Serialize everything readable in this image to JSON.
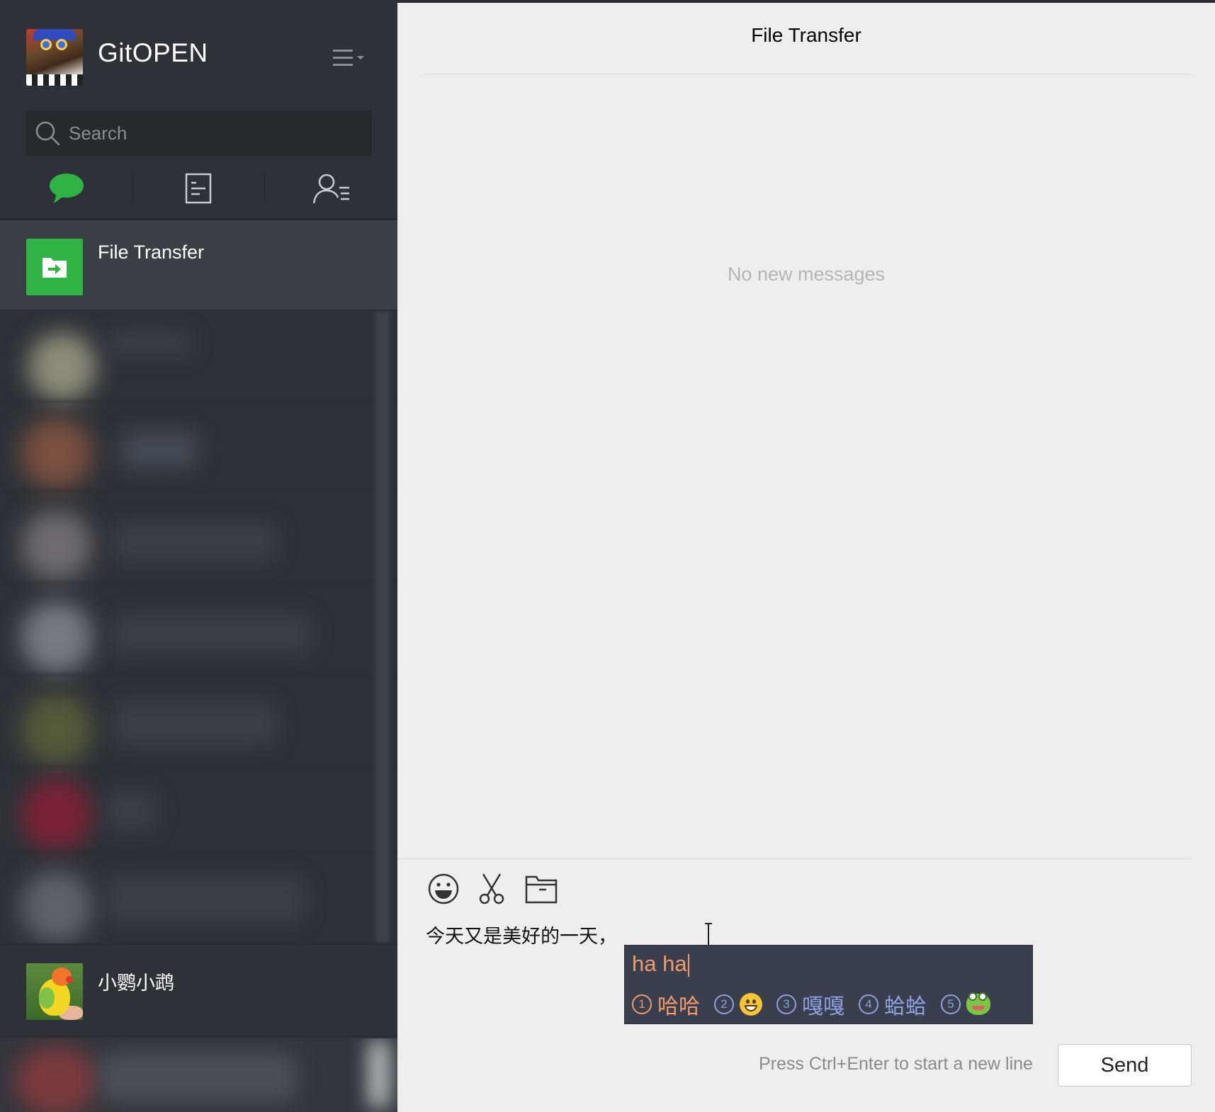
{
  "profile": {
    "name": "GitOPEN",
    "avatar_icon": "user-avatar-icon",
    "menu_icon": "menu-icon"
  },
  "search": {
    "placeholder": "Search",
    "icon": "search-icon"
  },
  "tabs": [
    {
      "name": "chats",
      "icon": "chat-bubble-icon",
      "active": true,
      "color": "#2fb344"
    },
    {
      "name": "articles",
      "icon": "document-icon",
      "active": false
    },
    {
      "name": "contacts",
      "icon": "contacts-icon",
      "active": false
    }
  ],
  "chats": [
    {
      "name": "File Transfer",
      "icon": "file-transfer-icon",
      "active": true
    },
    {
      "name": "小鹦小鹉",
      "icon": "parrot-avatar-icon",
      "active": false
    }
  ],
  "conversation": {
    "title": "File Transfer",
    "empty_text": "No new messages"
  },
  "composer": {
    "tools": [
      "emoji-icon",
      "scissors-icon",
      "folder-icon"
    ],
    "text": "今天又是美好的一天，",
    "hint": "Press Ctrl+Enter to start a new line",
    "send_label": "Send"
  },
  "ime": {
    "composition": "ha ha",
    "candidates": [
      {
        "num": "1",
        "text": "哈哈",
        "selected": true
      },
      {
        "num": "2",
        "text": "",
        "emoji": "grinning-face-icon",
        "selected": false
      },
      {
        "num": "3",
        "text": "嘎嘎",
        "selected": false
      },
      {
        "num": "4",
        "text": "蛤蛤",
        "selected": false
      },
      {
        "num": "5",
        "text": "",
        "emoji": "frog-icon",
        "selected": false
      }
    ]
  },
  "colors": {
    "sidebar_bg": "#2e3238",
    "accent_green": "#2fb344",
    "main_bg": "#eeeeee",
    "ime_bg": "#3a3f4d",
    "ime_selected": "#f19a6c",
    "ime_candidate": "#8ea0e0"
  }
}
